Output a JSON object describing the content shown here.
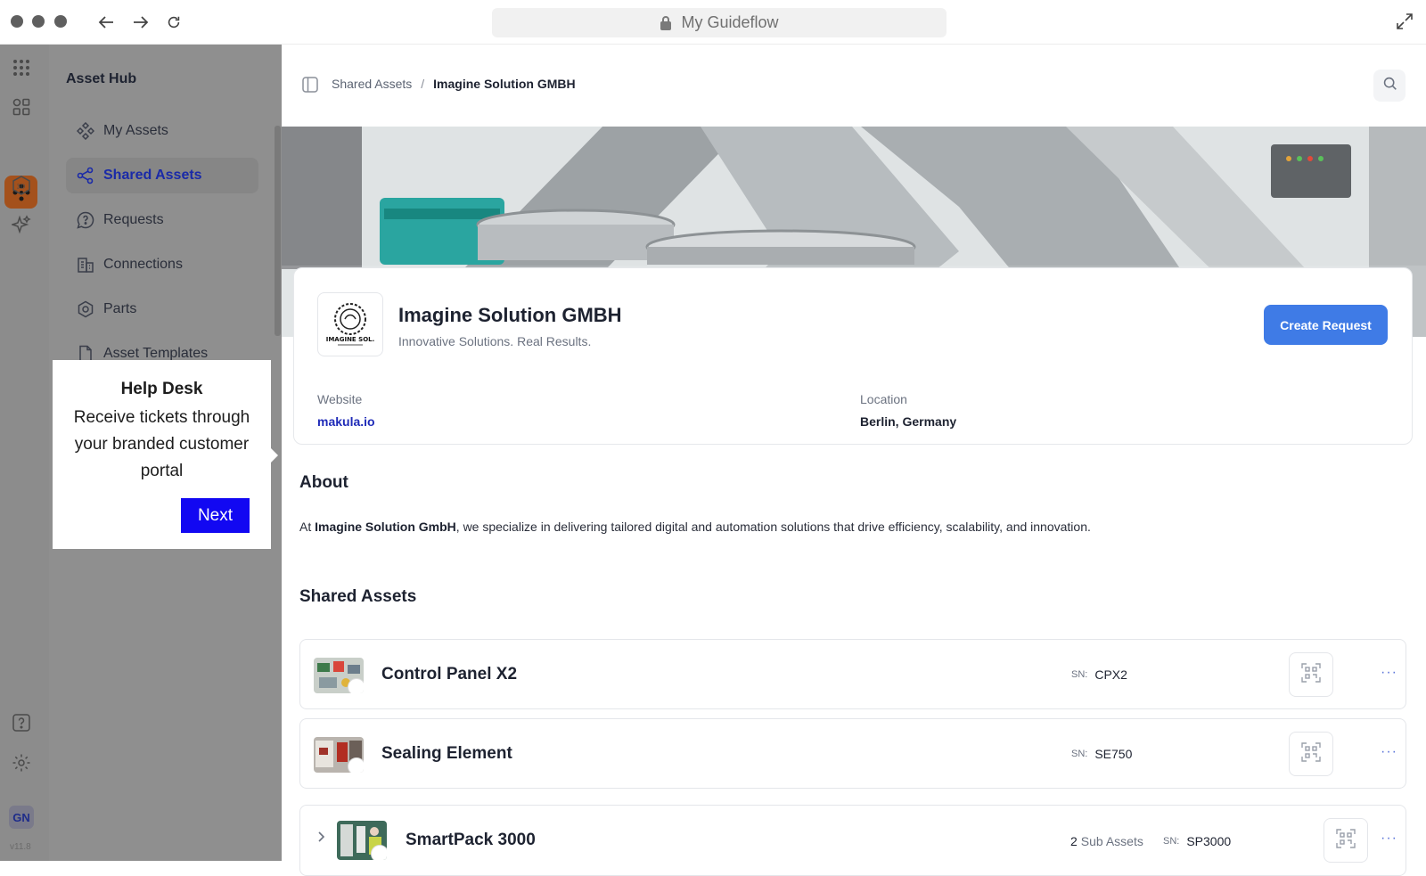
{
  "browser": {
    "url_title": "My Guideflow"
  },
  "sidebar": {
    "title": "Asset Hub",
    "items": [
      {
        "label": "My Assets"
      },
      {
        "label": "Shared Assets"
      },
      {
        "label": "Requests"
      },
      {
        "label": "Connections"
      },
      {
        "label": "Parts"
      },
      {
        "label": "Asset Templates"
      }
    ],
    "user_initials": "GN",
    "version": "v11.8"
  },
  "tooltip": {
    "title": "Help Desk",
    "body": "Receive tickets through your branded customer portal",
    "next_label": "Next"
  },
  "breadcrumb": {
    "parent": "Shared Assets",
    "separator": "/",
    "current": "Imagine Solution GMBH"
  },
  "company": {
    "logo_text": "IMAGINE SOL.",
    "name": "Imagine Solution GMBH",
    "tagline": "Innovative Solutions. Real Results.",
    "create_request_label": "Create Request",
    "website_label": "Website",
    "website": "makula.io",
    "location_label": "Location",
    "location": "Berlin, Germany"
  },
  "about": {
    "title": "About",
    "prefix": "At ",
    "company_bold": "Imagine Solution GmbH",
    "text": ", we specialize in delivering tailored digital and automation solutions that drive efficiency, scalability, and innovation."
  },
  "shared_assets": {
    "title": "Shared Assets",
    "sn_label": "SN:",
    "rows": [
      {
        "name": "Control Panel X2",
        "sn": "CPX2",
        "more": "···"
      },
      {
        "name": "Sealing Element",
        "sn": "SE750",
        "more": "···"
      },
      {
        "name": "SmartPack 3000",
        "sub_count": "2",
        "sub_label": "Sub Assets",
        "sn": "SP3000",
        "more": "···"
      }
    ]
  },
  "colors": {
    "accent": "#3f7be6",
    "tooltip_button": "#1208f2",
    "rail_active": "#a4511c",
    "active_nav_text": "#1a2aa8"
  }
}
